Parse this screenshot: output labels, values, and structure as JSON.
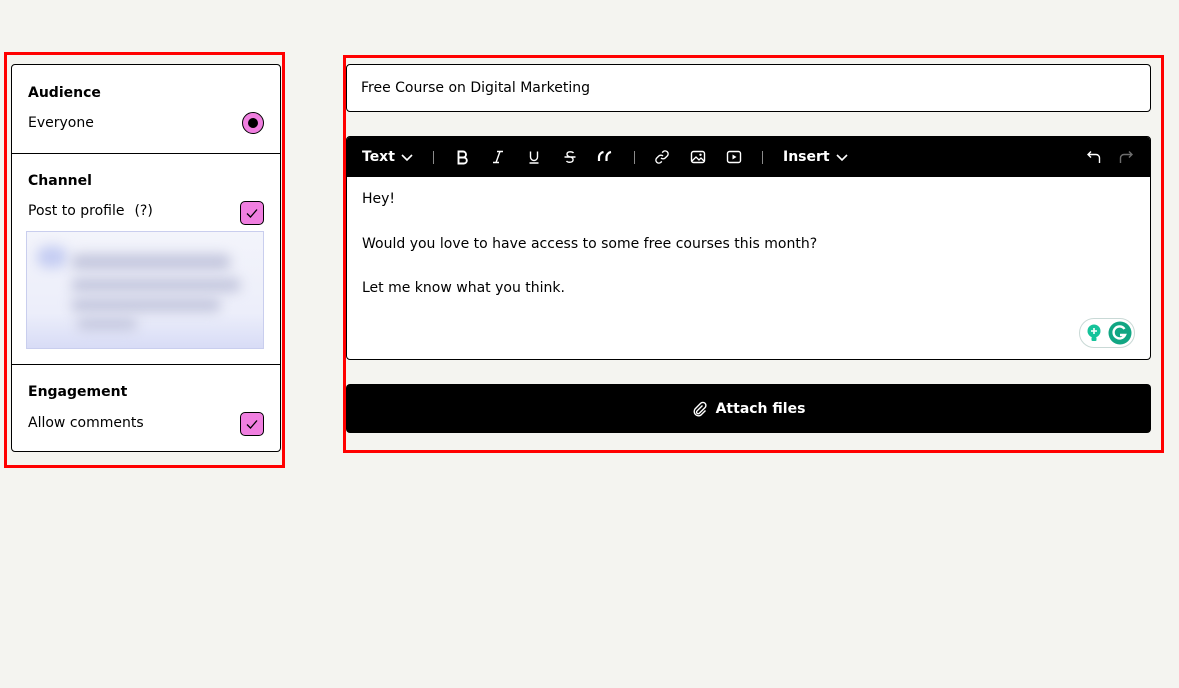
{
  "settings": {
    "audience": {
      "title": "Audience",
      "option_label": "Everyone",
      "selected": true
    },
    "channel": {
      "title": "Channel",
      "option_label": "Post to profile",
      "help": "(?)",
      "checked": true
    },
    "engagement": {
      "title": "Engagement",
      "option_label": "Allow comments",
      "checked": true
    }
  },
  "post": {
    "title_value": "Free Course on Digital Marketing"
  },
  "toolbar": {
    "text_style_label": "Text",
    "insert_label": "Insert",
    "icons": [
      "chevron-down-icon",
      "bold-icon",
      "italic-icon",
      "underline-icon",
      "strikethrough-icon",
      "quote-icon",
      "link-icon",
      "image-icon",
      "video-icon",
      "undo-icon",
      "redo-icon"
    ]
  },
  "editor": {
    "lines": [
      "Hey!",
      "Would you love to have access to some free courses this month?",
      "Let me know what you think."
    ]
  },
  "attach": {
    "label": "Attach files"
  },
  "colors": {
    "background": "#f4f4f0",
    "accent_pink": "#f07fe0",
    "highlight_red": "#ff0000",
    "toolbar_black": "#000000",
    "grammarly_green": "#15c39a"
  }
}
